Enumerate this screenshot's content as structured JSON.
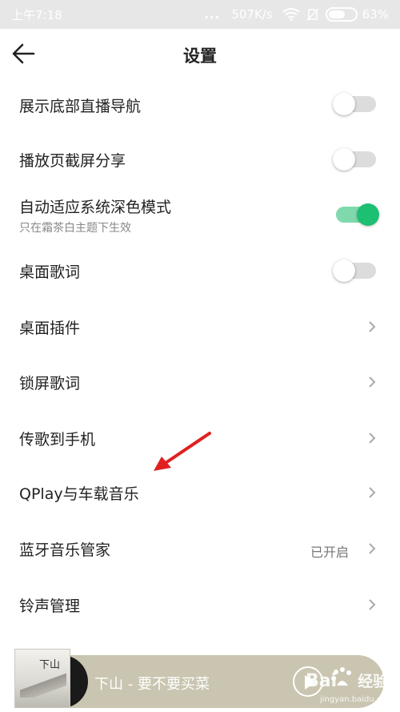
{
  "status_bar": {
    "time": "上午7:18",
    "dots": "...",
    "speed": "507K/s",
    "battery": "63%",
    "battery_level": 0.63
  },
  "header": {
    "title": "设置",
    "back_icon": "arrow-left-icon"
  },
  "settings": [
    {
      "label": "展示底部直播导航",
      "control": "toggle",
      "on": false
    },
    {
      "label": "播放页截屏分享",
      "control": "toggle",
      "on": false
    },
    {
      "label": "自动适应系统深色模式",
      "sublabel": "只在霜茶白主题下生效",
      "control": "toggle",
      "on": true
    },
    {
      "label": "桌面歌词",
      "control": "toggle",
      "on": false
    },
    {
      "label": "桌面插件",
      "control": "chevron"
    },
    {
      "label": "锁屏歌词",
      "control": "chevron"
    },
    {
      "label": "传歌到手机",
      "control": "chevron"
    },
    {
      "label": "QPlay与车载音乐",
      "control": "chevron"
    },
    {
      "label": "蓝牙音乐管家",
      "value": "已开启",
      "control": "chevron"
    },
    {
      "label": "铃声管理",
      "control": "chevron"
    }
  ],
  "mini_player": {
    "song": "下山 - 要不要买菜",
    "cover_text": "下山"
  },
  "watermark": {
    "brand": "Bai",
    "brand_suffix": "经验",
    "url": "jingyan.baidu.com"
  },
  "colors": {
    "accent": "#1dbf73",
    "toggle_on_track": "#7fd9ac",
    "status_bar": "#e7e7e7",
    "arrow": "#e02020"
  }
}
